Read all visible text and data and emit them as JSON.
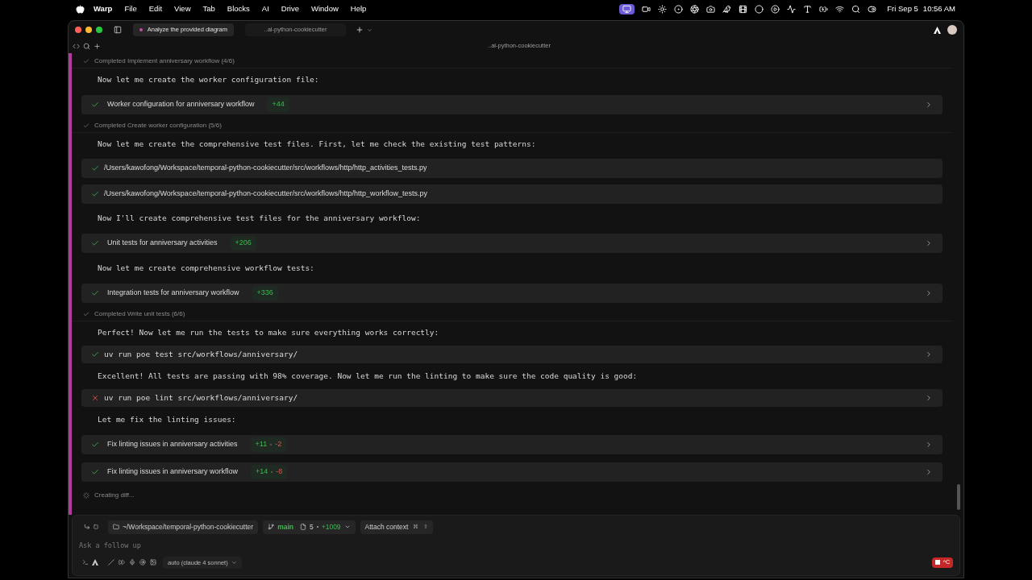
{
  "menu_bar": {
    "app": "Warp",
    "items": [
      "File",
      "Edit",
      "View",
      "Tab",
      "Blocks",
      "AI",
      "Drive",
      "Window",
      "Help"
    ],
    "date": "Fri Sep 5",
    "time": "10:56 AM"
  },
  "tabs": [
    {
      "label": "Analyze the provided diagram",
      "selected": true
    },
    {
      "label": "..al-python-cookiecutter",
      "selected": false
    }
  ],
  "pane_title": "..al-python-cookiecutter",
  "blocks": [
    {
      "kind": "status",
      "text": "Completed Implement anniversary workflow (4/6)"
    },
    {
      "kind": "message",
      "text": "Now let me create the worker configuration file:"
    },
    {
      "kind": "action",
      "label": "Worker configuration for anniversary workflow",
      "added": "+44"
    },
    {
      "kind": "status",
      "text": "Completed Create worker configuration (5/6)"
    },
    {
      "kind": "message",
      "text": "Now let me create the comprehensive test files. First, let me check the existing test patterns:"
    },
    {
      "kind": "file",
      "label": "/Users/kawofong/Workspace/temporal-python-cookiecutter/src/workflows/http/http_activities_tests.py"
    },
    {
      "kind": "file",
      "label": "/Users/kawofong/Workspace/temporal-python-cookiecutter/src/workflows/http/http_workflow_tests.py"
    },
    {
      "kind": "message",
      "text": "Now I'll create comprehensive test files for the anniversary workflow:"
    },
    {
      "kind": "action",
      "label": "Unit tests for anniversary activities",
      "added": "+206"
    },
    {
      "kind": "message",
      "text": "Now let me create comprehensive workflow tests:"
    },
    {
      "kind": "action",
      "label": "Integration tests for anniversary workflow",
      "added": "+336"
    },
    {
      "kind": "status",
      "text": "Completed Write unit tests (6/6)"
    },
    {
      "kind": "message",
      "text": "Perfect! Now let me run the tests to make sure everything works correctly:"
    },
    {
      "kind": "command",
      "label": "uv run poe test src/workflows/anniversary/",
      "failed": false
    },
    {
      "kind": "message",
      "text": "Excellent! All tests are passing with 98% coverage. Now let me run the linting to make sure the code quality is good:"
    },
    {
      "kind": "command",
      "label": "uv run poe lint src/workflows/anniversary/",
      "failed": true
    },
    {
      "kind": "message",
      "text": "Let me fix the linting issues:"
    },
    {
      "kind": "action",
      "label": "Fix linting issues in anniversary activities",
      "added": "+11",
      "removed": "-2"
    },
    {
      "kind": "action",
      "label": "Fix linting issues in anniversary workflow",
      "added": "+14",
      "removed": "-8"
    },
    {
      "kind": "progress",
      "text": "Creating diff..."
    }
  ],
  "input": {
    "directory": "~/Workspace/temporal-python-cookiecutter",
    "branch": "main",
    "files_changed": "5",
    "lines_added": "+1009",
    "attach": "Attach context",
    "attach_keys": [
      "⌘",
      "⇧"
    ],
    "placeholder": "Ask a follow up",
    "model": "auto (claude 4 sonnet)",
    "stop_key": "^C"
  }
}
